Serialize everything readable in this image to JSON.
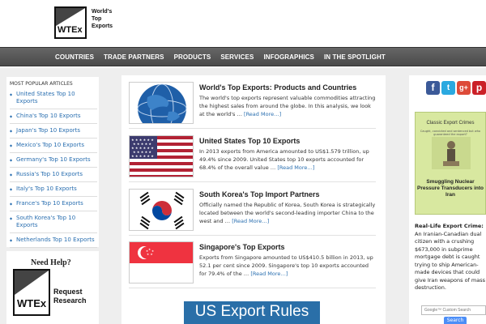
{
  "header": {
    "logo_text": "WTEx",
    "tagline": [
      "World's",
      "Top",
      "Exports"
    ]
  },
  "nav": {
    "items": [
      "COUNTRIES",
      "TRADE PARTNERS",
      "PRODUCTS",
      "SERVICES",
      "INFOGRAPHICS",
      "IN THE SPOTLIGHT"
    ]
  },
  "sidebar_left": {
    "title": "MOST POPULAR ARTICLES",
    "items": [
      "United States Top 10 Exports",
      "China's Top 10 Exports",
      "Japan's Top 10 Exports",
      "Mexico's Top 10 Exports",
      "Germany's Top 10 Exports",
      "Russia's Top 10 Exports",
      "Italy's Top 10 Exports",
      "France's Top 10 Exports",
      "South Korea's Top 10 Exports",
      "Netherlands Top 10 Exports"
    ],
    "need_help": {
      "title": "Need Help?",
      "logo_text": "WTEx",
      "cta_line1": "Request",
      "cta_line2": "Research"
    }
  },
  "articles": [
    {
      "title": "World's Top Exports: Products and Countries",
      "body": "The world's top exports represent valuable commodities attracting the highest sales from around the globe. In this analysis, we look at the world's …",
      "more": "[Read More…]",
      "thumb_icon": "globe-icon"
    },
    {
      "title": "United States Top 10 Exports",
      "body": "In 2013 exports from America amounted to US$1.579 trillion, up 49.4% since 2009. United States top 10 exports accounted for 68.4% of the overall value …",
      "more": "[Read More…]",
      "thumb_icon": "us-flag-icon"
    },
    {
      "title": "South Korea's Top Import Partners",
      "body": "Officially named the Republic of Korea, South Korea is strategically located between the world's second-leading importer China to the west and …",
      "more": "[Read More…]",
      "thumb_icon": "south-korea-flag-icon"
    },
    {
      "title": "Singapore's Top Exports",
      "body": "Exports from Singapore amounted to US$410.5 billion in 2013, up 52.1 per cent since 2009. Singapore's top 10 exports accounted for 79.4% of the …",
      "more": "[Read More…]",
      "thumb_icon": "singapore-flag-icon"
    }
  ],
  "banner": {
    "label": "US Export Rules"
  },
  "sidebar_right": {
    "social": [
      {
        "name": "facebook-icon",
        "glyph": "f"
      },
      {
        "name": "twitter-icon",
        "glyph": "t"
      },
      {
        "name": "google-plus-icon",
        "glyph": "g+"
      },
      {
        "name": "pinterest-icon",
        "glyph": "p"
      }
    ],
    "book": {
      "title": "Classic Export Crimes",
      "subtitle": "Caught, convicted and sentenced but who guaranteed the export?",
      "big_title": "Smuggling Nuclear Pressure Transducers into Iran"
    },
    "crime": {
      "heading": "Real-Life Export Crime:",
      "text": "An Iranian-Canadian dual citizen with a crushing $673,000 in subprime mortgage debt is caught trying to ship American-made devices that could give Iran weapons of mass destruction."
    },
    "search": {
      "placeholder": "Google™ Custom Search",
      "button": "Search"
    }
  },
  "colors": {
    "nav_bg": "#555555",
    "link": "#2a6fb0",
    "banner": "#2a6fa8",
    "book": "#d8e8a0"
  }
}
